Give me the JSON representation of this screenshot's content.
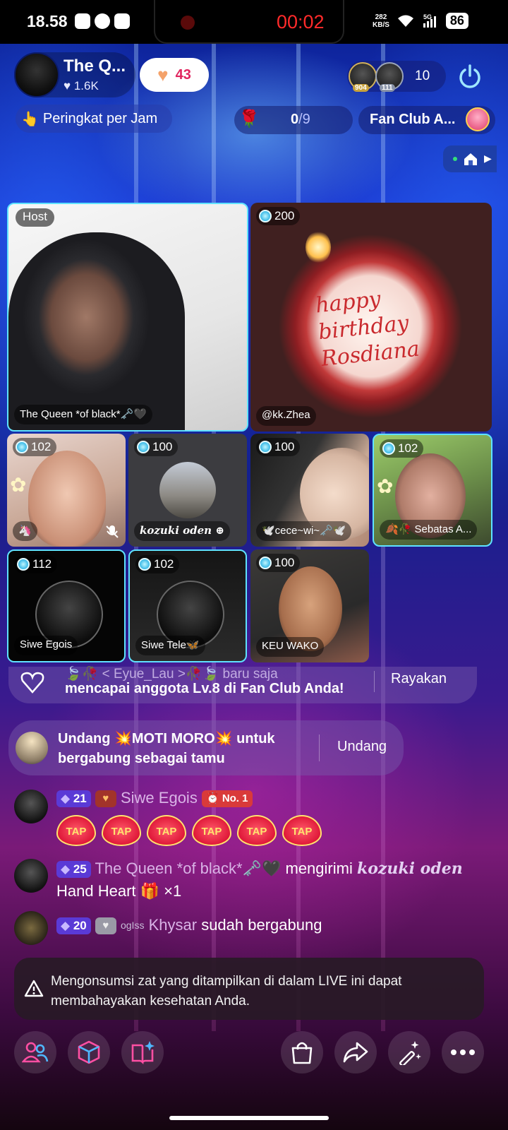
{
  "status_bar": {
    "time": "18.58",
    "record_timer": "00:02",
    "net_speed_value": "282",
    "net_speed_unit": "KB/S",
    "network": "5G",
    "battery": "86"
  },
  "header": {
    "host_name": "The Q...",
    "host_likes": "1.6K",
    "likes_count": "43",
    "viewer_badges": [
      "904",
      "111"
    ],
    "viewer_count": "10"
  },
  "subbar": {
    "ranking_label": "Peringkat per Jam",
    "rose_progress": "0",
    "rose_goal": "/9",
    "fan_club_label": "Fan Club A..."
  },
  "tiles": [
    {
      "badge": "Host",
      "name": "The Queen *of black*🗝️🖤"
    },
    {
      "badge": "200",
      "name": "@kk.Zhea"
    },
    {
      "badge": "102",
      "name": "🦄"
    },
    {
      "badge": "100",
      "name": "kozuki oden"
    },
    {
      "badge": "100",
      "name": "🕊️cece~wi~🗝️🕊️"
    },
    {
      "badge": "102",
      "name": "🍂🥀 Sebatas A..."
    },
    {
      "badge": "112",
      "name": "Siwe Egois"
    },
    {
      "badge": "102",
      "name": "Siwe Tele🦋"
    },
    {
      "badge": "100",
      "name": "KEU WAKO"
    }
  ],
  "cake_text": [
    "happy",
    "birthday",
    "Rosdiana"
  ],
  "notices": {
    "fanclub_top": "🍃🥀 < Eyue_Lau >🥀🍃 baru saja",
    "fanclub_text": "mencapai anggota Lv.8 di Fan Club Anda!",
    "fanclub_action": "Rayakan",
    "invite_text": "Undang 💥MOTI MORO💥 untuk bergabung sebagai tamu",
    "invite_action": "Undang"
  },
  "chat": [
    {
      "level": "21",
      "name": "Siwe Egois",
      "rank": "No. 1",
      "taps": [
        "TAP",
        "TAP",
        "TAP",
        "TAP",
        "TAP",
        "TAP"
      ]
    },
    {
      "level": "25",
      "name": "The Queen *of black*🗝️🖤",
      "action": "mengirimi",
      "target": "kozuki oden",
      "gift": "Hand Heart 🎁 ×1"
    },
    {
      "level": "20",
      "tag": "ogIss",
      "name": "Khysar",
      "action": "sudah bergabung"
    }
  ],
  "warning": "Mengonsumsi zat yang ditampilkan di dalam LIVE ini dapat membahayakan kesehatan Anda.",
  "icons": {
    "colors": {
      "accent": "#5fe2ff",
      "pink": "#ff4fa3",
      "timer": "#ff2a2a"
    }
  }
}
